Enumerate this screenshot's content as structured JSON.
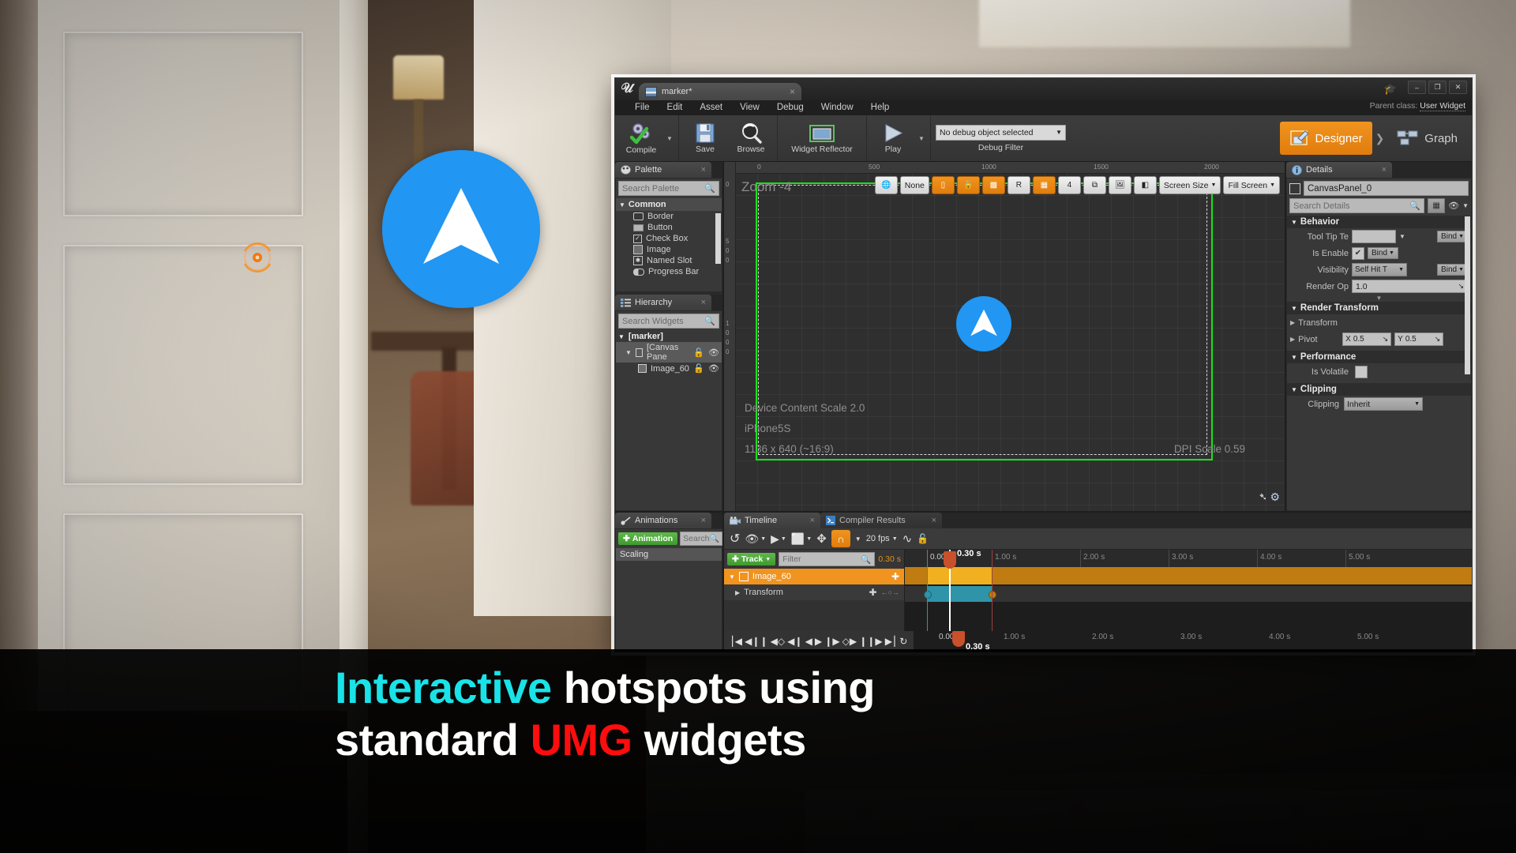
{
  "caption": {
    "line1_accent": "Interactive",
    "line1_rest": " hotspots using",
    "line2_pre": "standard ",
    "line2_accent": "UMG",
    "line2_rest": " widgets",
    "accent1_color": "#19e3e8",
    "accent2_color": "#fd0d0d"
  },
  "window": {
    "tab_title": "marker*",
    "tab_close": "×",
    "parent_class_label": "Parent class:",
    "parent_class_value": "User Widget",
    "minimize": "–",
    "maximize": "❐",
    "close": "✕"
  },
  "menubar": {
    "items": [
      "File",
      "Edit",
      "Asset",
      "View",
      "Debug",
      "Window",
      "Help"
    ]
  },
  "toolbar": {
    "compile": "Compile",
    "save": "Save",
    "browse": "Browse",
    "widget_reflector": "Widget Reflector",
    "play": "Play",
    "debug_object": "No debug object selected",
    "debug_filter_label": "Debug Filter",
    "mode_designer": "Designer",
    "mode_graph": "Graph",
    "mode_separator": "❯"
  },
  "palette": {
    "tab_title": "Palette",
    "search_placeholder": "Search Palette",
    "category": "Common",
    "items": [
      "Border",
      "Button",
      "Check Box",
      "Image",
      "Named Slot",
      "Progress Bar"
    ]
  },
  "hierarchy": {
    "tab_title": "Hierarchy",
    "search_placeholder": "Search Widgets",
    "root": "[marker]",
    "items": [
      {
        "label": "[Canvas Pane",
        "selected": true
      },
      {
        "label": "Image_60",
        "selected": false
      }
    ]
  },
  "animations": {
    "tab_title": "Animations",
    "add_button": "Animation",
    "search_placeholder": "Search",
    "list": [
      "Scaling"
    ]
  },
  "canvas": {
    "zoom_label": "Zoom  -4",
    "ruler_ticks": [
      "0",
      "500",
      "1000",
      "1500",
      "2000"
    ],
    "ruler_ticks_v": [
      "0",
      "5",
      "0",
      "0",
      "1",
      "0",
      "0",
      "0"
    ],
    "toolbar_buttons": [
      {
        "name": "localization-preview",
        "glyph": "🌐",
        "active": false
      },
      {
        "name": "none-dropdown",
        "glyph": "None",
        "active": false,
        "wide": true
      },
      {
        "name": "fill-screen-toggle",
        "glyph": "▭",
        "active": true
      },
      {
        "name": "lock-aspect",
        "glyph": "🔒",
        "active": true
      },
      {
        "name": "outline-toggle",
        "glyph": "⬛",
        "active": true
      },
      {
        "name": "resolution-r",
        "glyph": "R",
        "active": false
      },
      {
        "name": "grid-snap",
        "glyph": "▦",
        "active": true
      },
      {
        "name": "grid-size",
        "glyph": "4",
        "active": false
      },
      {
        "name": "size-to-content",
        "glyph": "⧉",
        "active": false
      },
      {
        "name": "image-preview",
        "glyph": "🏞",
        "active": false
      },
      {
        "name": "mirror-toggle",
        "glyph": "◧",
        "active": false
      },
      {
        "name": "screen-size-dropdown",
        "glyph": "Screen Size",
        "active": false,
        "wide": true
      },
      {
        "name": "fill-screen-dropdown",
        "glyph": "Fill Screen",
        "active": false,
        "wide": true
      }
    ],
    "device_content_scale": "Device Content Scale 2.0",
    "device_name": "iPhone5S",
    "resolution": "1136 x 640 (~16:9)",
    "dpi_scale": "DPI Scale 0.59"
  },
  "details": {
    "tab_title": "Details",
    "object_name": "CanvasPanel_0",
    "search_placeholder": "Search Details",
    "sections": [
      {
        "title": "Behavior",
        "rows": [
          {
            "label": "Tool Tip Te",
            "type": "combo",
            "value": "",
            "bind": "Bind"
          },
          {
            "label": "Is Enable",
            "type": "check",
            "value": "✔",
            "bind": "Bind"
          },
          {
            "label": "Visibility",
            "type": "combo",
            "value": "Self Hit T",
            "bind": "Bind"
          },
          {
            "label": "Render Op",
            "type": "text",
            "value": "1.0",
            "bind": ""
          }
        ]
      },
      {
        "title": "Render Transform",
        "rows": [
          {
            "label": "Transform",
            "type": "expand",
            "value": "",
            "bind": ""
          },
          {
            "label": "Pivot",
            "type": "xy",
            "x_label": "X",
            "x_value": "0.5",
            "y_label": "Y",
            "y_value": "0.5"
          }
        ]
      },
      {
        "title": "Performance",
        "rows": [
          {
            "label": "Is Volatile",
            "type": "check",
            "value": "",
            "bind": ""
          }
        ]
      },
      {
        "title": "Clipping",
        "rows": [
          {
            "label": "Clipping",
            "type": "combo",
            "value": "Inherit",
            "bind": ""
          }
        ]
      }
    ]
  },
  "timeline": {
    "tabs": [
      {
        "label": "Timeline",
        "active": true
      },
      {
        "label": "Compiler Results",
        "active": false
      }
    ],
    "fps": "20 fps",
    "track_button": "Track",
    "filter_placeholder": "Filter",
    "current_time": "0.30 s",
    "playhead_time_top": "0.30 s",
    "playhead_time_bottom": "0.30 s",
    "start_time": "0.00",
    "ruler_marks": [
      "1.00 s",
      "2.00 s",
      "3.00 s",
      "4.00 s",
      "5.00 s"
    ],
    "tracks": [
      {
        "label": "Image_60",
        "type": "object",
        "add": "✚"
      },
      {
        "label": "Transform",
        "type": "sub",
        "add": "✚"
      }
    ],
    "transport_glyphs": [
      "⎮◀",
      "◀❙❙",
      "◀◇",
      "◀❙",
      "◀",
      "▶",
      "❙▶",
      "◇▶",
      "❙❙▶",
      "▶⎮",
      "↻"
    ]
  },
  "colors": {
    "accent_orange": "#f0941f",
    "green_frame": "#19e119",
    "hotspot_blue": "#2196f3",
    "hotspot_orange": "#f07818"
  }
}
